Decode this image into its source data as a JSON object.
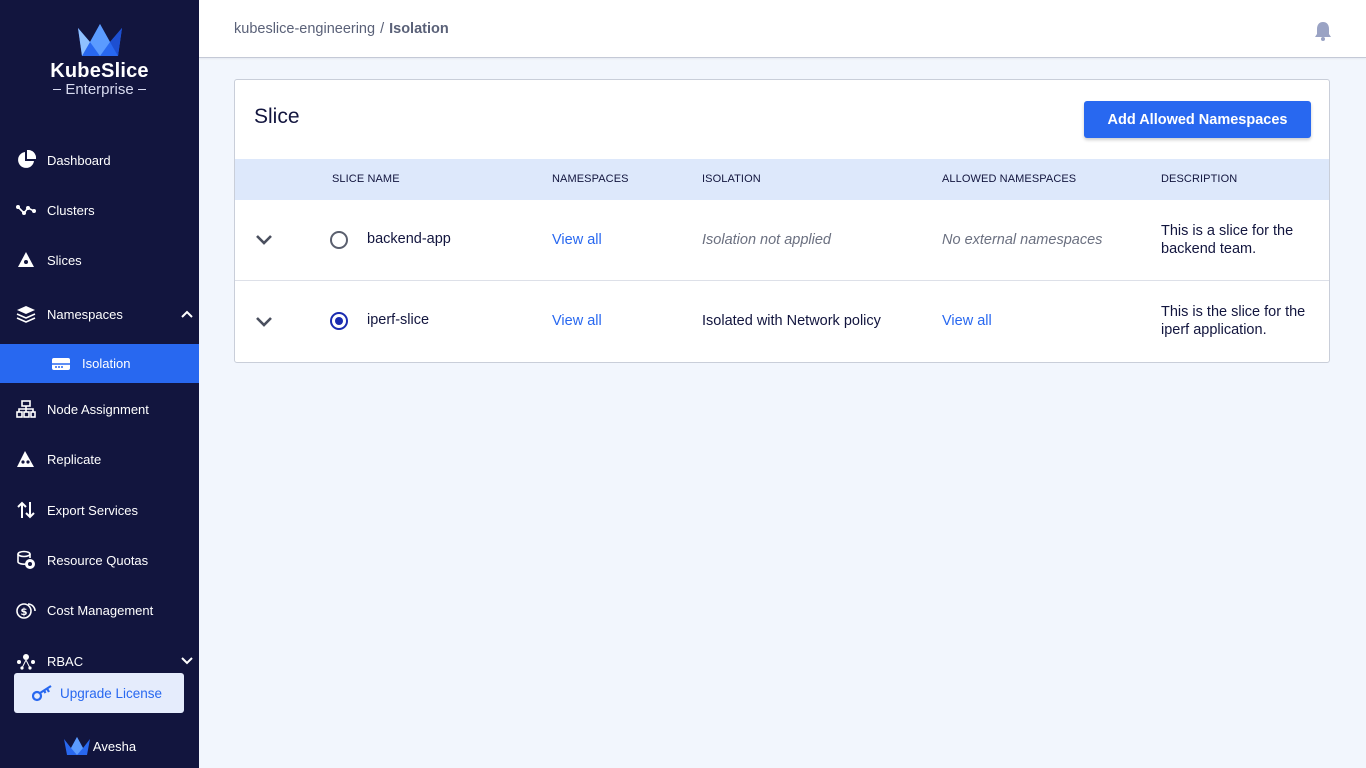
{
  "brand": {
    "title": "KubeSlice",
    "subtitle": "Enterprise",
    "footer": "Avesha"
  },
  "sidebar": {
    "items": [
      {
        "label": "Dashboard",
        "icon": "pie-chart-icon"
      },
      {
        "label": "Clusters",
        "icon": "network-nodes-icon"
      },
      {
        "label": "Slices",
        "icon": "slice-icon"
      },
      {
        "label": "Namespaces",
        "icon": "layers-icon"
      },
      {
        "label": "Isolation",
        "icon": "server-icon"
      },
      {
        "label": "Node Assignment",
        "icon": "hierarchy-icon"
      },
      {
        "label": "Replicate",
        "icon": "replicate-icon"
      },
      {
        "label": "Export Services",
        "icon": "up-down-arrows-icon"
      },
      {
        "label": "Resource Quotas",
        "icon": "coins-icon"
      },
      {
        "label": "Cost Management",
        "icon": "dollar-coins-icon"
      },
      {
        "label": "RBAC",
        "icon": "rbac-icon"
      }
    ],
    "upgrade_label": "Upgrade License"
  },
  "header": {
    "breadcrumb": {
      "parent": "kubeslice-engineering",
      "separator": "/",
      "current": "Isolation"
    }
  },
  "card": {
    "title": "Slice",
    "add_button": "Add Allowed Namespaces",
    "columns": [
      "SLICE NAME",
      "NAMESPACES",
      "ISOLATION",
      "ALLOWED NAMESPACES",
      "DESCRIPTION"
    ],
    "rows": [
      {
        "slice_name": "backend-app",
        "selected": false,
        "namespaces": "View all",
        "isolation": "Isolation not applied",
        "allowed_namespaces": "No external namespaces",
        "description": "This is a slice for the backend team."
      },
      {
        "slice_name": "iperf-slice",
        "selected": true,
        "namespaces": "View all",
        "isolation": "Isolated with Network policy",
        "allowed_namespaces": "View all",
        "description": "This is the slice for the iperf application."
      }
    ]
  },
  "colors": {
    "sidebar_bg": "#12153e",
    "accent": "#2868f0",
    "table_header_bg": "#dde8fb",
    "page_bg": "#f2f6fd"
  }
}
